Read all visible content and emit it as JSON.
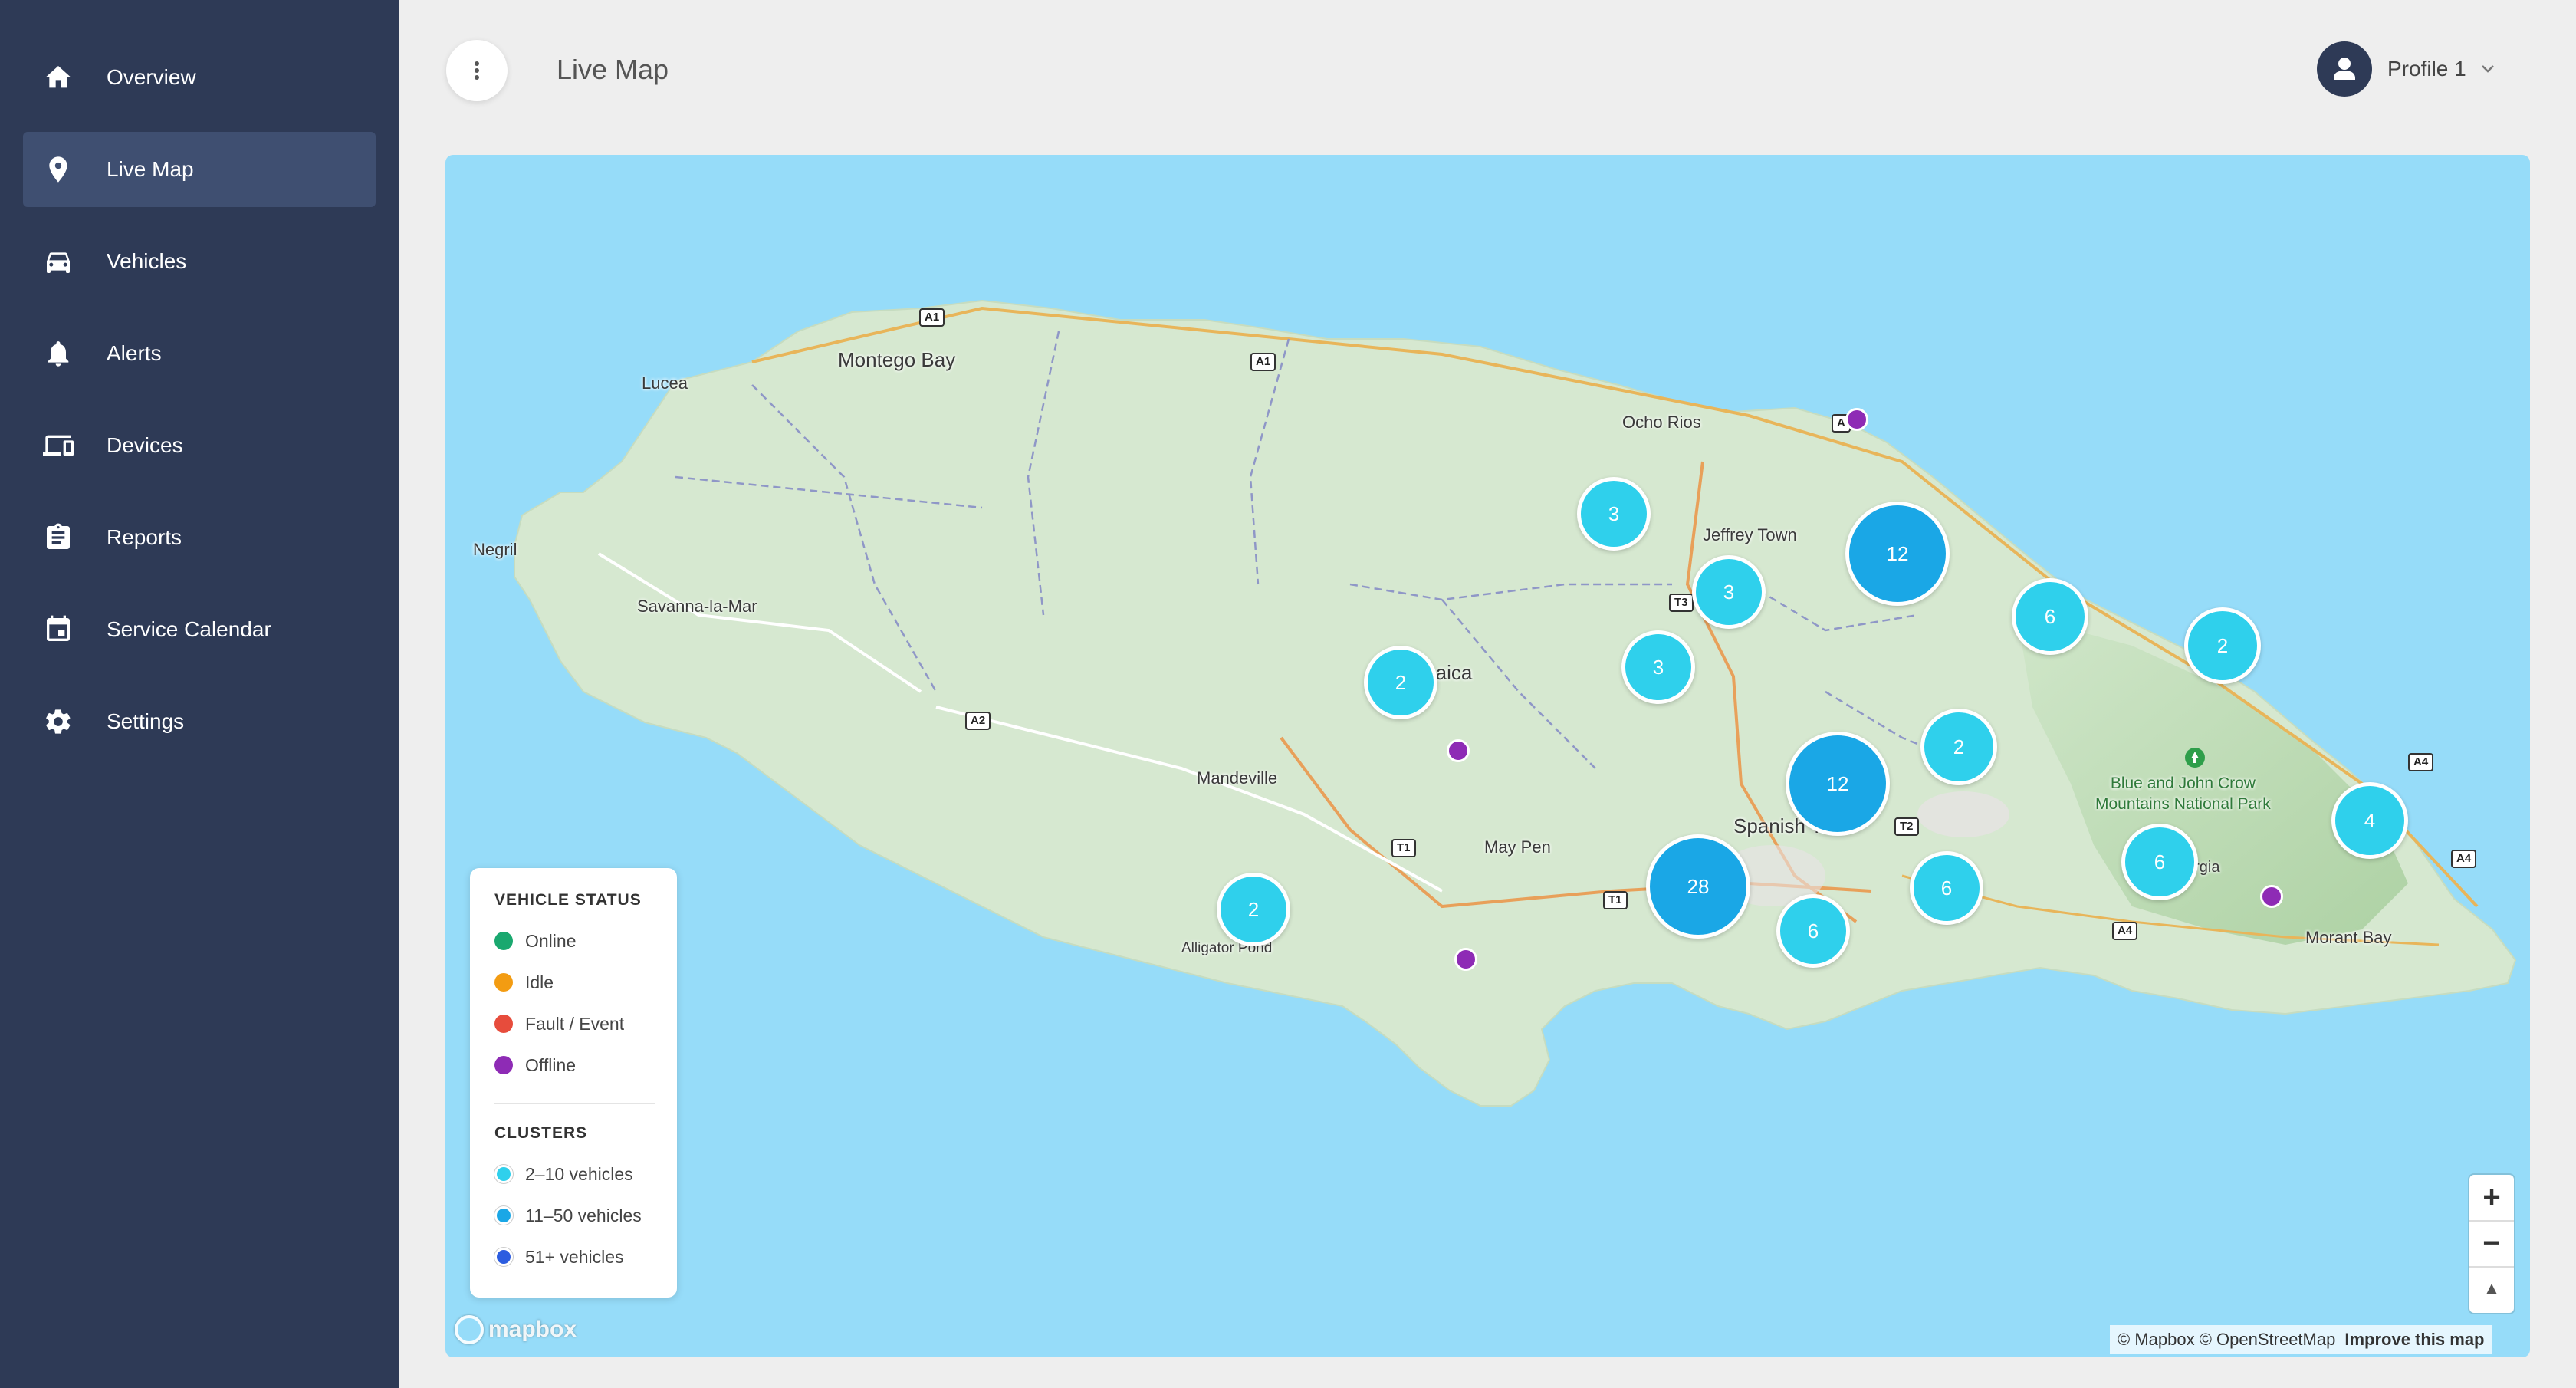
{
  "sidebar": {
    "items": [
      {
        "label": "Overview",
        "icon": "home-icon"
      },
      {
        "label": "Live Map",
        "icon": "map-pin-icon",
        "active": true
      },
      {
        "label": "Vehicles",
        "icon": "car-icon"
      },
      {
        "label": "Alerts",
        "icon": "bell-icon"
      },
      {
        "label": "Devices",
        "icon": "devices-icon"
      },
      {
        "label": "Reports",
        "icon": "clipboard-icon"
      },
      {
        "label": "Service Calendar",
        "icon": "calendar-icon"
      },
      {
        "label": "Settings",
        "icon": "gear-icon"
      }
    ]
  },
  "header": {
    "title": "Live Map",
    "profile": "Profile 1",
    "menu_icon": "more-vertical-icon",
    "avatar_icon": "person-icon"
  },
  "map": {
    "places": {
      "montego_bay": "Montego Bay",
      "lucea": "Lucea",
      "negril": "Negril",
      "savanna": "Savanna-la-Mar",
      "ocho_rios": "Ocho Rios",
      "jeffrey_town": "Jeffrey Town",
      "jamaica": "maica",
      "mandeville": "Mandeville",
      "may_pen": "May Pen",
      "spanish_town": "Spanish T  n",
      "alligator_pond": "Alligator Pond",
      "park": "Blue and John Crow\nMountains National Park",
      "georgia": "orgia",
      "morant_bay": "Morant Bay"
    },
    "shields": [
      "A1",
      "A1",
      "A",
      "T3",
      "A2",
      "T1",
      "T1",
      "T2",
      "A4",
      "A4",
      "A4"
    ],
    "clusters": [
      {
        "count": "3",
        "size": "small"
      },
      {
        "count": "12",
        "size": "medium"
      },
      {
        "count": "3",
        "size": "small"
      },
      {
        "count": "6",
        "size": "small"
      },
      {
        "count": "2",
        "size": "small"
      },
      {
        "count": "2",
        "size": "small"
      },
      {
        "count": "3",
        "size": "small"
      },
      {
        "count": "2",
        "size": "small"
      },
      {
        "count": "12",
        "size": "medium"
      },
      {
        "count": "4",
        "size": "small"
      },
      {
        "count": "6",
        "size": "small"
      },
      {
        "count": "6",
        "size": "small"
      },
      {
        "count": "28",
        "size": "medium"
      },
      {
        "count": "6",
        "size": "small"
      },
      {
        "count": "2",
        "size": "small"
      }
    ],
    "offline_markers": 4,
    "legend": {
      "status_heading": "VEHICLE STATUS",
      "statuses": [
        {
          "label": "Online",
          "color": "#1aa86f"
        },
        {
          "label": "Idle",
          "color": "#f39c12"
        },
        {
          "label": "Fault / Event",
          "color": "#e74c3c"
        },
        {
          "label": "Offline",
          "color": "#8e2bb5"
        }
      ],
      "clusters_heading": "CLUSTERS",
      "clusters": [
        {
          "label": "2–10 vehicles",
          "color": "#2fd0ec"
        },
        {
          "label": "11–50 vehicles",
          "color": "#1aa7e6"
        },
        {
          "label": "51+ vehicles",
          "color": "#2c5de0"
        }
      ]
    },
    "controls": {
      "zoom_in": "+",
      "zoom_out": "−",
      "compass": "▲"
    },
    "attribution": {
      "text": "© Mapbox © OpenStreetMap",
      "improve": "Improve this map"
    },
    "logo": "mapbox"
  }
}
